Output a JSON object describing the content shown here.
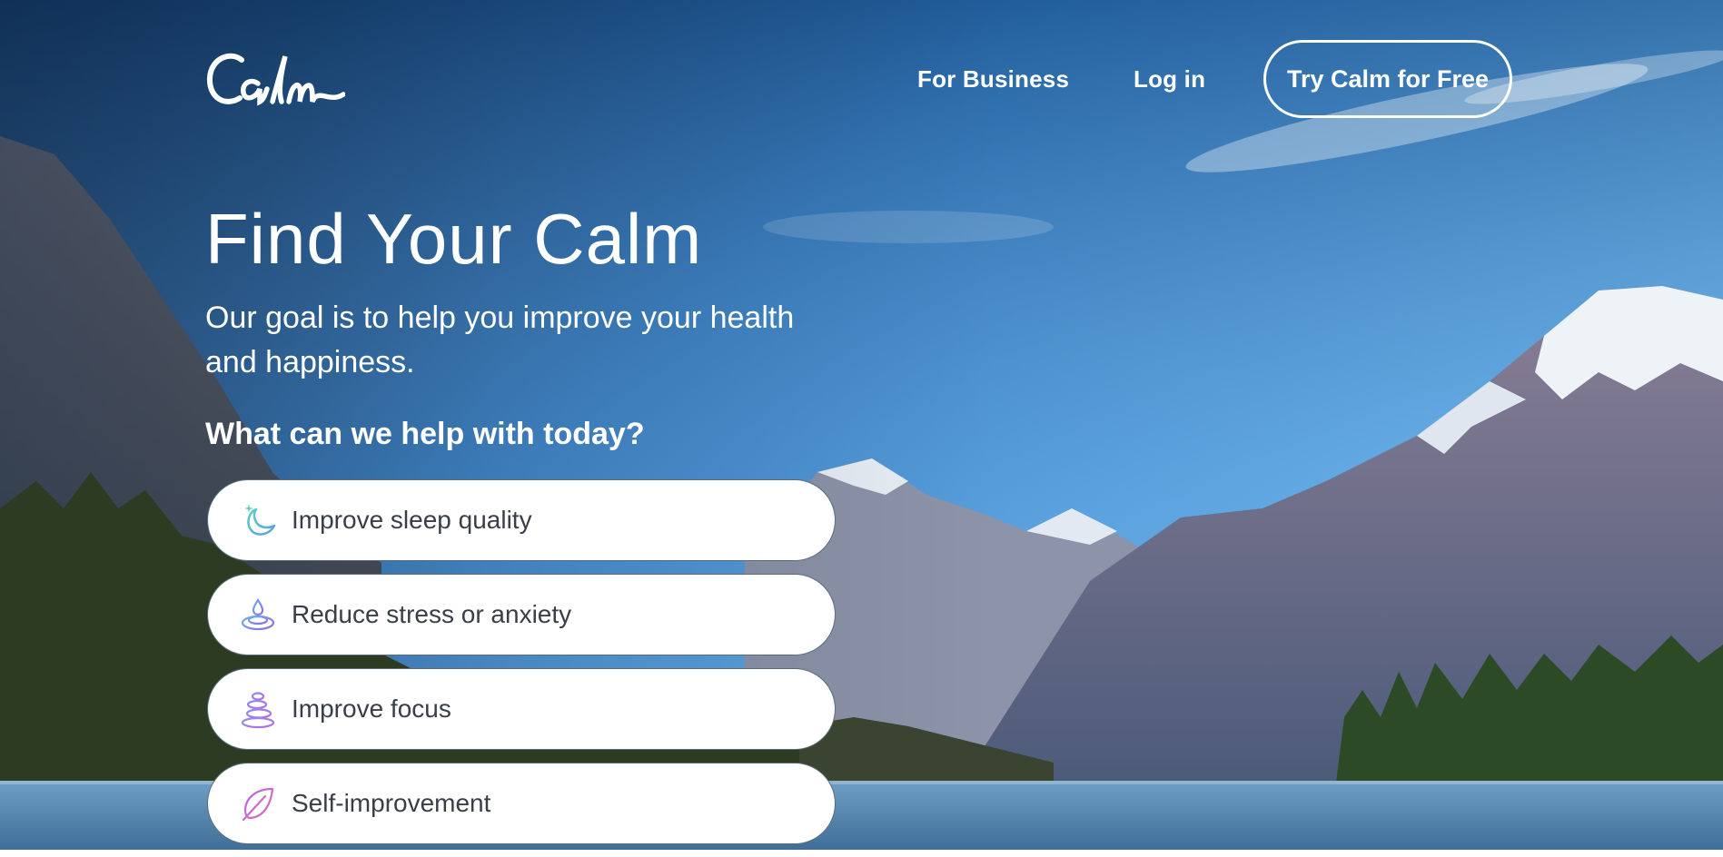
{
  "header": {
    "logo_text": "Calm",
    "nav": {
      "for_business": "For Business",
      "log_in": "Log in",
      "cta": "Try Calm for Free"
    }
  },
  "hero": {
    "title": "Find Your Calm",
    "subtitle": "Our goal is to help you improve your health and happiness.",
    "question": "What can we help with today?"
  },
  "options": [
    {
      "label": "Improve sleep quality",
      "icon": "moon-icon"
    },
    {
      "label": "Reduce stress or anxiety",
      "icon": "water-drop-icon"
    },
    {
      "label": "Improve focus",
      "icon": "stacked-stones-icon"
    },
    {
      "label": "Self-improvement",
      "icon": "leaf-icon"
    }
  ],
  "colors": {
    "sky_top": "#1e5fa3",
    "sky_mid": "#3b8fdc",
    "option_text": "#3a3f47",
    "icon_gradient_start": "#5fd0c8",
    "icon_gradient_end": "#b36ae0"
  }
}
